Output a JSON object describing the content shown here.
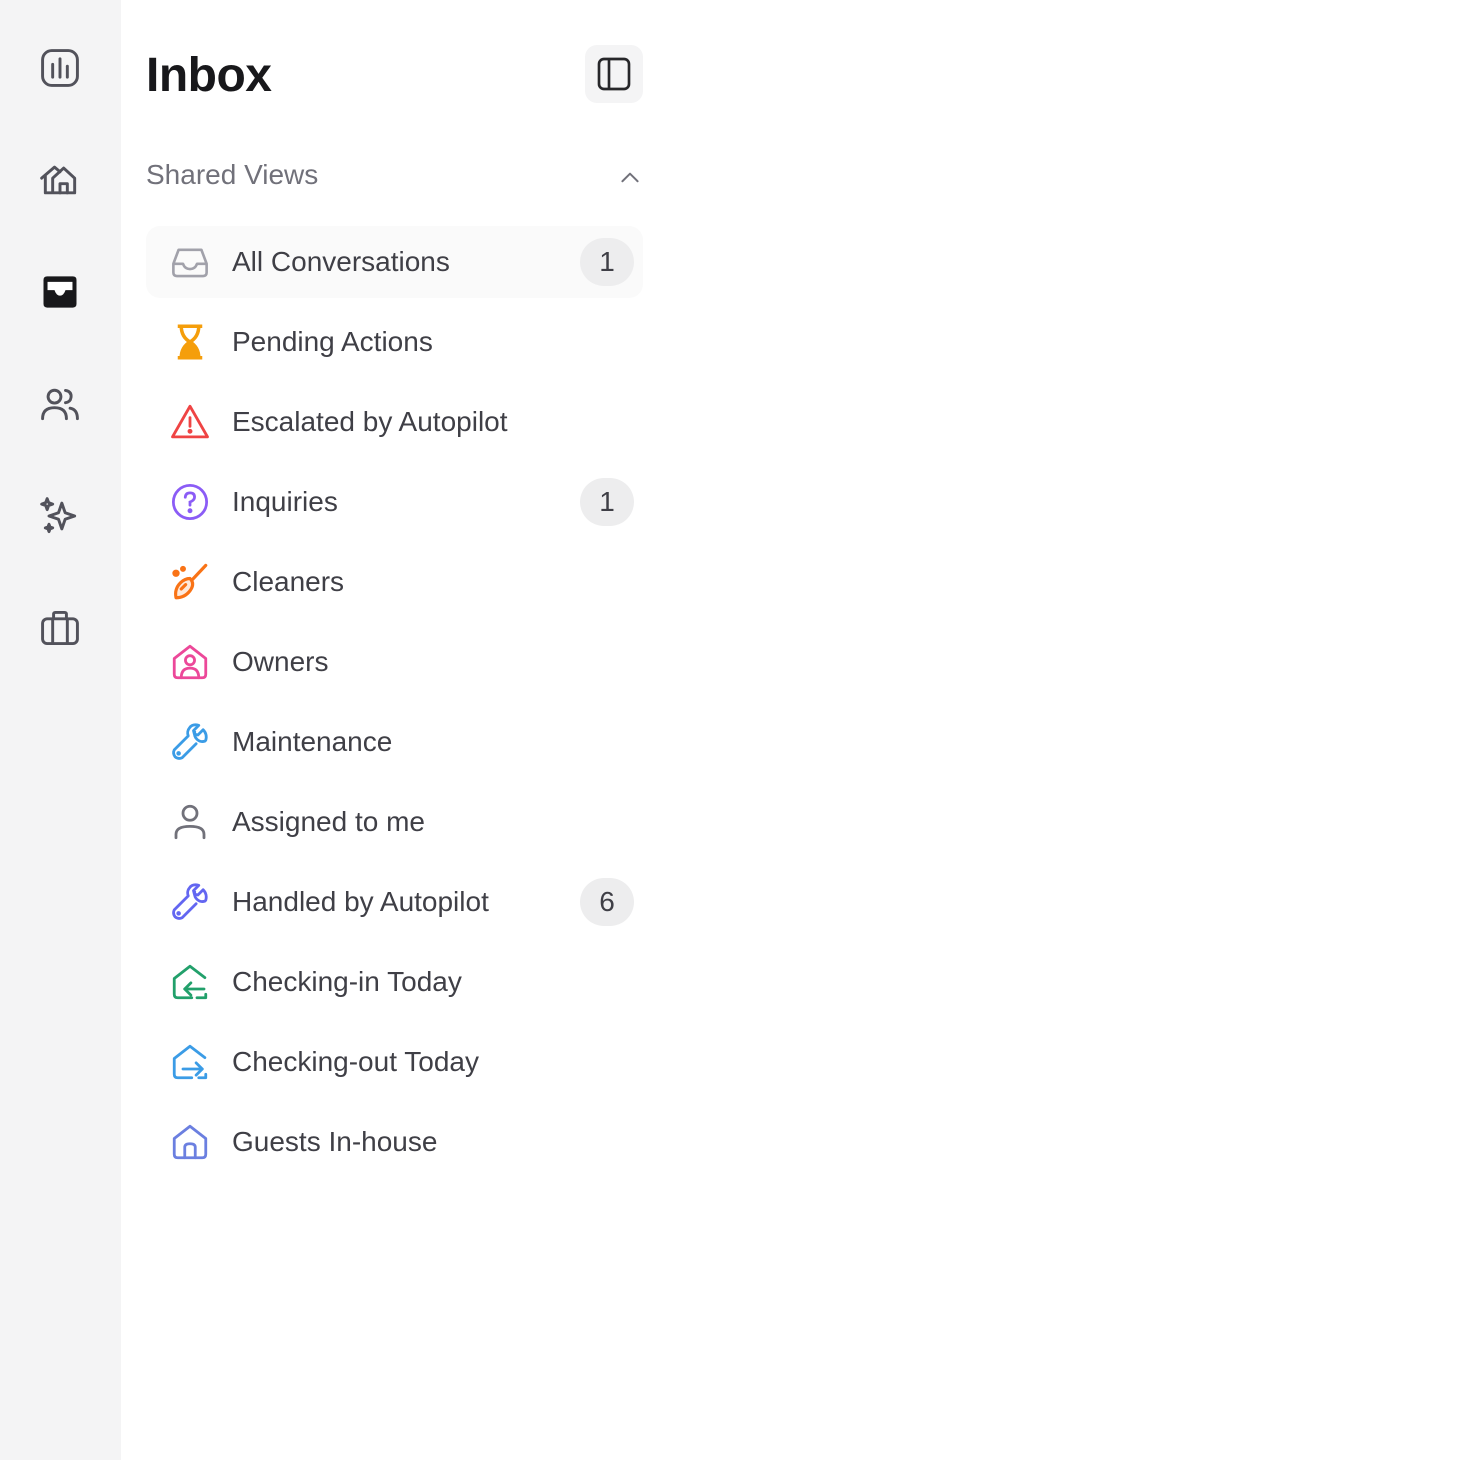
{
  "rail": {
    "items": [
      {
        "name": "analytics",
        "icon": "bar-chart-icon"
      },
      {
        "name": "properties",
        "icon": "houses-icon"
      },
      {
        "name": "inbox",
        "icon": "inbox-tray-icon",
        "active": true
      },
      {
        "name": "contacts",
        "icon": "users-icon"
      },
      {
        "name": "autopilot",
        "icon": "sparkles-icon"
      },
      {
        "name": "operations",
        "icon": "briefcase-icon"
      }
    ]
  },
  "panel": {
    "title": "Inbox",
    "section_title": "Shared Views",
    "section_expanded": true,
    "views": [
      {
        "label": "All Conversations",
        "badge": "1",
        "icon": "inbox-icon",
        "color": "#a1a1aa",
        "active": true
      },
      {
        "label": "Pending Actions",
        "badge": "",
        "icon": "hourglass-icon",
        "color": "#f59e0b"
      },
      {
        "label": "Escalated by Autopilot",
        "badge": "",
        "icon": "warning-triangle-icon",
        "color": "#ef4444"
      },
      {
        "label": "Inquiries",
        "badge": "1",
        "icon": "question-circle-icon",
        "color": "#8b5cf6"
      },
      {
        "label": "Cleaners",
        "badge": "",
        "icon": "broom-icon",
        "color": "#f97316"
      },
      {
        "label": "Owners",
        "badge": "",
        "icon": "owner-house-icon",
        "color": "#ec4899"
      },
      {
        "label": "Maintenance",
        "badge": "",
        "icon": "wrench-icon",
        "color": "#3b9ce6"
      },
      {
        "label": "Assigned to me",
        "badge": "",
        "icon": "user-icon",
        "color": "#71717a"
      },
      {
        "label": "Handled by Autopilot",
        "badge": "6",
        "icon": "wrench-icon",
        "color": "#6366f1"
      },
      {
        "label": "Checking-in Today",
        "badge": "",
        "icon": "check-in-house-icon",
        "color": "#22a06b"
      },
      {
        "label": "Checking-out Today",
        "badge": "",
        "icon": "check-out-house-icon",
        "color": "#3b9ce6"
      },
      {
        "label": "Guests In-house",
        "badge": "",
        "icon": "house-icon",
        "color": "#6b7fe0"
      }
    ]
  }
}
